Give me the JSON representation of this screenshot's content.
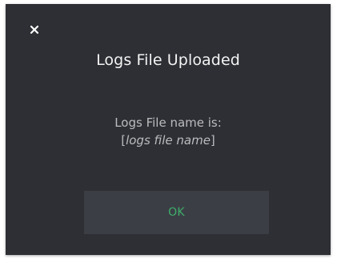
{
  "dialog": {
    "title": "Logs File Uploaded",
    "message_line1": "Logs File name is:",
    "bracket_open": "[",
    "filename": "logs file name",
    "bracket_close": "]",
    "ok_label": "OK",
    "close_icon": "close-icon"
  },
  "colors": {
    "background": "#2e2f35",
    "button": "#3b3f45",
    "ok_text": "#3fae6a",
    "title_text": "#f3f3f3",
    "body_text": "#bcbcbe"
  }
}
